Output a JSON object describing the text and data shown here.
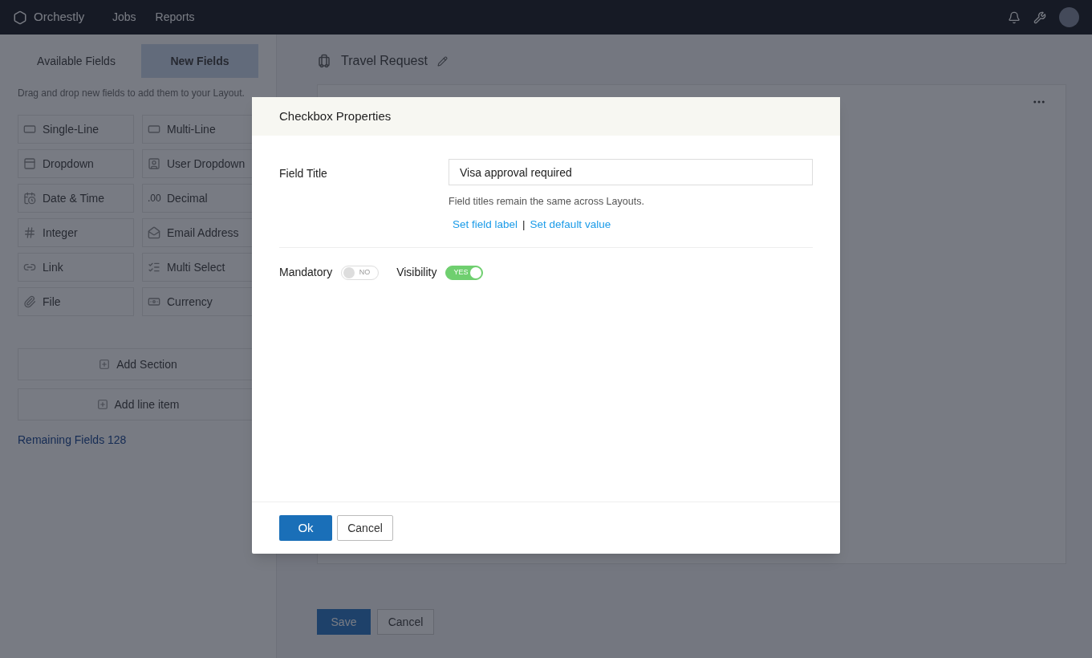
{
  "topbar": {
    "brand": "Orchestly",
    "nav": [
      {
        "label": "Jobs"
      },
      {
        "label": "Reports"
      }
    ]
  },
  "sidebar": {
    "tabs": [
      {
        "label": "Available Fields",
        "selected": false
      },
      {
        "label": "New Fields",
        "selected": true
      }
    ],
    "hint": "Drag and drop new fields to add them to your Layout.",
    "fields": [
      {
        "label": "Single-Line"
      },
      {
        "label": "Multi-Line"
      },
      {
        "label": "Dropdown"
      },
      {
        "label": "User Dropdown"
      },
      {
        "label": "Date & Time"
      },
      {
        "label": "Decimal",
        "glyph": ".00"
      },
      {
        "label": "Integer"
      },
      {
        "label": "Email Address"
      },
      {
        "label": "Link"
      },
      {
        "label": "Multi Select"
      },
      {
        "label": "File"
      },
      {
        "label": "Currency"
      }
    ],
    "actions": [
      {
        "label": "Add Section"
      },
      {
        "label": "Add line item"
      }
    ],
    "remaining": "Remaining Fields 128"
  },
  "form": {
    "title": "Travel Request",
    "save": "Save",
    "cancel": "Cancel"
  },
  "dialog": {
    "title": "Checkbox Properties",
    "field_label": "Field Title",
    "value": "Visa approval required",
    "help": "Field titles remain the same across Layouts.",
    "links": [
      "Set field label",
      "Set default value"
    ],
    "link_separator": "|",
    "toggles": [
      {
        "label": "Mandatory",
        "on": false,
        "text": "NO"
      },
      {
        "label": "Visibility",
        "on": true,
        "text": "YES"
      }
    ],
    "ok": "Ok",
    "cancel": "Cancel"
  }
}
